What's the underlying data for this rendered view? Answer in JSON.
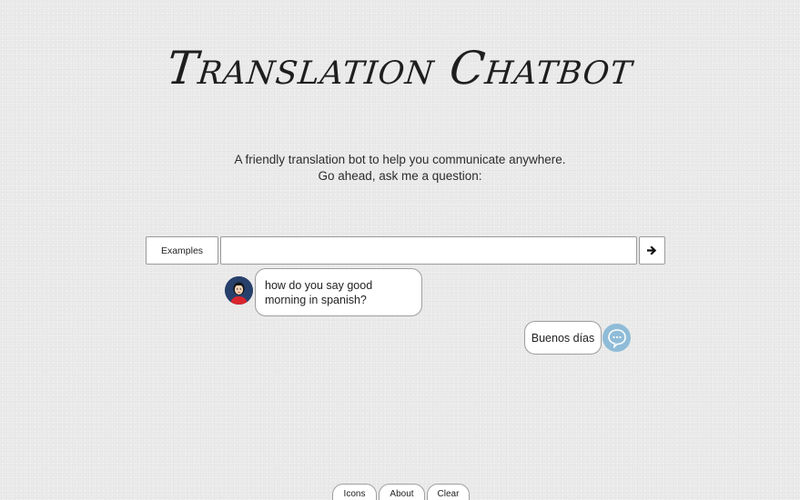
{
  "header": {
    "title": "Translation Chatbot",
    "subtitle_line1": "A friendly translation bot to help you communicate anywhere.",
    "subtitle_line2": "Go ahead, ask me a question:"
  },
  "input_bar": {
    "examples_label": "Examples",
    "input_value": "",
    "input_placeholder": "",
    "send_icon": "arrow-right-icon"
  },
  "conversation": [
    {
      "sender": "user",
      "text": "how do you say good morning in spanish?",
      "avatar_icon": "user-avatar-icon"
    },
    {
      "sender": "bot",
      "text": "Buenos días",
      "avatar_icon": "chat-bubble-icon"
    }
  ],
  "footer": {
    "icons_label": "Icons",
    "about_label": "About",
    "clear_label": "Clear"
  },
  "colors": {
    "background": "#ebebeb",
    "bot_avatar": "#8fbcd8",
    "user_avatar": "#2a3e66"
  }
}
